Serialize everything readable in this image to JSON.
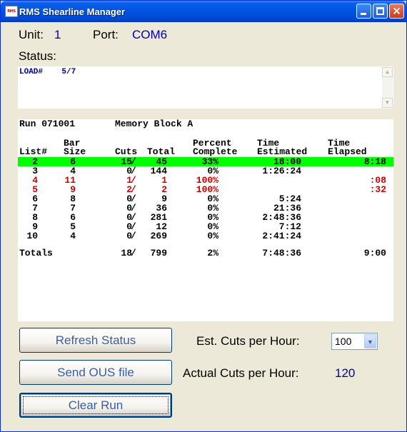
{
  "window": {
    "title": "RMS Shearline Manager",
    "app_icon_text": "RMS",
    "close_glyph": "×"
  },
  "connection": {
    "unit_label": "Unit:",
    "unit_value": "1",
    "port_label": "Port:",
    "port_value": "COM6"
  },
  "status": {
    "label": "Status:",
    "lines": [
      "LOAD#    5/7"
    ],
    "scroll_up_icon": "▲",
    "scroll_down_icon": "▼"
  },
  "run": {
    "run_label": "Run 071001",
    "memory_label": "Memory Block A",
    "headers": {
      "list": [
        "List#"
      ],
      "bar_size": [
        "Bar",
        "Size"
      ],
      "cuts": [
        "Cuts"
      ],
      "total": [
        "Total"
      ],
      "percent": [
        "Percent",
        "Complete"
      ],
      "time_estimated": [
        "Time",
        "Estimated"
      ],
      "time_elapsed": [
        "Time",
        "Elapsed"
      ]
    },
    "rows": [
      {
        "list": "2",
        "bar_size": "6",
        "cuts": "15",
        "total": "45",
        "percent": "33%",
        "est": "18:00",
        "elapsed": "8:18",
        "state": "active"
      },
      {
        "list": "3",
        "bar_size": "4",
        "cuts": "0",
        "total": "144",
        "percent": "0%",
        "est": "1:26:24",
        "elapsed": "",
        "state": "normal"
      },
      {
        "list": "4",
        "bar_size": "11",
        "cuts": "1",
        "total": "1",
        "percent": "100%",
        "est": "",
        "elapsed": ":08",
        "state": "done"
      },
      {
        "list": "5",
        "bar_size": "9",
        "cuts": "2",
        "total": "2",
        "percent": "100%",
        "est": "",
        "elapsed": ":32",
        "state": "done"
      },
      {
        "list": "6",
        "bar_size": "8",
        "cuts": "0",
        "total": "9",
        "percent": "0%",
        "est": "5:24",
        "elapsed": "",
        "state": "normal"
      },
      {
        "list": "7",
        "bar_size": "7",
        "cuts": "0",
        "total": "36",
        "percent": "0%",
        "est": "21:36",
        "elapsed": "",
        "state": "normal"
      },
      {
        "list": "8",
        "bar_size": "6",
        "cuts": "0",
        "total": "281",
        "percent": "0%",
        "est": "2:48:36",
        "elapsed": "",
        "state": "normal"
      },
      {
        "list": "9",
        "bar_size": "5",
        "cuts": "0",
        "total": "12",
        "percent": "0%",
        "est": "7:12",
        "elapsed": "",
        "state": "normal"
      },
      {
        "list": "10",
        "bar_size": "4",
        "cuts": "0",
        "total": "269",
        "percent": "0%",
        "est": "2:41:24",
        "elapsed": "",
        "state": "normal"
      }
    ],
    "totals": {
      "label": "Totals",
      "cuts": "18",
      "total": "799",
      "percent": "2%",
      "est": "7:48:36",
      "elapsed": "9:00"
    },
    "separator": "/"
  },
  "buttons": {
    "refresh": "Refresh Status",
    "send": "Send OUS file",
    "clear": "Clear Run"
  },
  "rates": {
    "est_label": "Est. Cuts per Hour:",
    "est_value": "100",
    "dropdown_icon": "▼",
    "actual_label": "Actual Cuts per Hour:",
    "actual_value": "120"
  },
  "colors": {
    "title_bar": "#0053e1",
    "active_row": "#00ff00",
    "done_text": "#cc0000",
    "value_text": "#0000a8",
    "button_text": "#3a5ea5"
  }
}
